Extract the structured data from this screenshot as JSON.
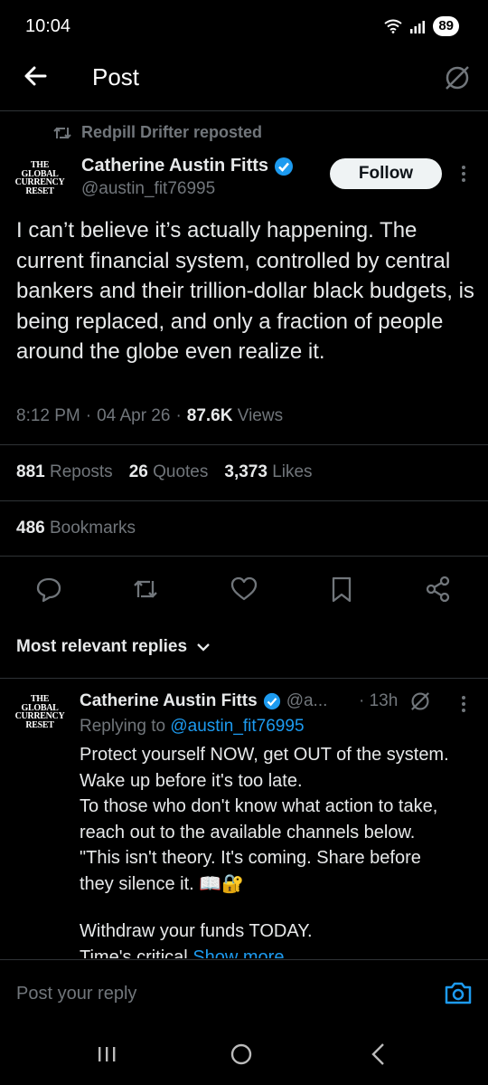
{
  "status": {
    "time": "10:04",
    "battery": "89"
  },
  "header": {
    "title": "Post"
  },
  "repost": {
    "text": "Redpill Drifter reposted"
  },
  "author": {
    "name": "Catherine Austin Fitts",
    "handle": "@austin_fit76995",
    "avatar_text": [
      "THE GLOBAL",
      "CURRENCY",
      "RESET"
    ]
  },
  "follow": {
    "label": "Follow"
  },
  "tweet": {
    "text": "I can’t believe it’s actually happening. The current financial system, controlled by central bankers and their trillion-dollar black budgets, is being replaced, and only a fraction of people around the globe even realize it.",
    "time": "8:12 PM",
    "date": "04 Apr 26",
    "views_count": "87.6K",
    "views_label": "Views"
  },
  "stats": {
    "reposts_count": "881",
    "reposts_label": "Reposts",
    "quotes_count": "26",
    "quotes_label": "Quotes",
    "likes_count": "3,373",
    "likes_label": "Likes",
    "bookmarks_count": "486",
    "bookmarks_label": "Bookmarks"
  },
  "replies": {
    "sort_label": "Most relevant replies",
    "first": {
      "name": "Catherine Austin Fitts",
      "handle": "@a...",
      "time": "· 13h",
      "replying_prefix": "Replying to",
      "replying_handle": "@austin_fit76995",
      "lines": [
        "Protect yourself NOW, get OUT of the system.",
        "Wake up before it's too late.",
        "To those who don't know what action to take,",
        "reach out to the available channels below.",
        "\"This isn't theory. It's coming. Share before",
        "they silence it. 📖🔐"
      ],
      "withdraw": "Withdraw your funds TODAY.",
      "partial": "Time's critical",
      "show_more": "Show more"
    }
  },
  "reply_bar": {
    "placeholder": "Post your reply"
  },
  "colors": {
    "accent": "#1d9bf0",
    "muted": "#71767b",
    "background": "#000000",
    "text": "#e7e9ea"
  }
}
